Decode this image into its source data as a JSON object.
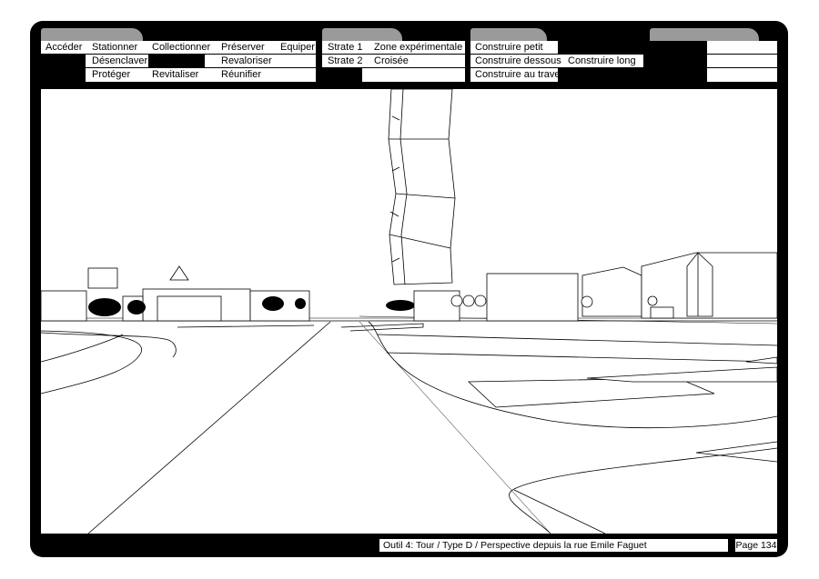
{
  "group1": {
    "row1": [
      "Accéder",
      "Stationner",
      "Collectionner",
      "Préserver",
      "Equiper"
    ],
    "row2": [
      "Désenclaver",
      "Revaloriser"
    ],
    "row3": [
      "Protéger",
      "Revitaliser",
      "Réunifier"
    ]
  },
  "group2": {
    "row1": [
      "Strate 1",
      "Zone expérimentale"
    ],
    "row2": [
      "Strate 2",
      "Croisée"
    ]
  },
  "group3": {
    "row1": [
      "Construire petit"
    ],
    "row2": [
      "Construire dessous",
      "Construire long"
    ],
    "row3": [
      "Construire au travers"
    ]
  },
  "footer": {
    "caption": "Outil 4:  Tour / Type D / Perspective depuis la rue Emile Faguet",
    "page": "Page 134"
  }
}
